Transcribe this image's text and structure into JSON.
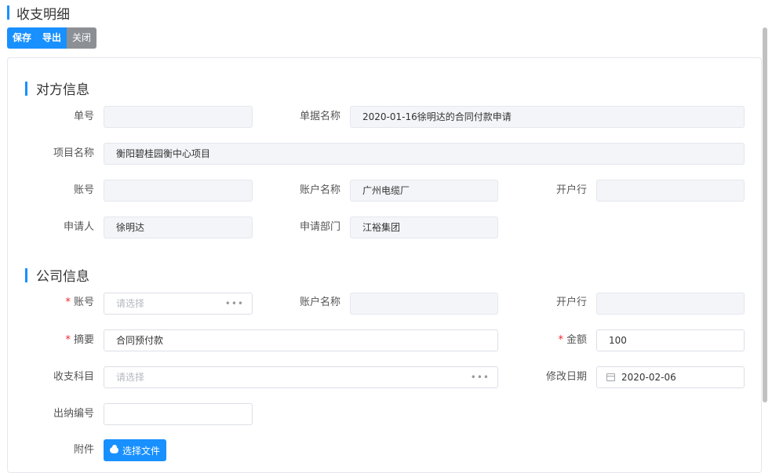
{
  "page": {
    "title": "收支明细"
  },
  "toolbar": {
    "save": "保存",
    "export": "导出",
    "close": "关闭"
  },
  "counterparty": {
    "section_title": "对方信息",
    "doc_no": {
      "label": "单号",
      "value": ""
    },
    "doc_name": {
      "label": "单据名称",
      "value": "2020-01-16徐明达的合同付款申请"
    },
    "project_name": {
      "label": "项目名称",
      "value": "衡阳碧桂园衡中心项目"
    },
    "account_no": {
      "label": "账号",
      "value": ""
    },
    "account_name": {
      "label": "账户名称",
      "value": "广州电缆厂"
    },
    "bank": {
      "label": "开户行",
      "value": ""
    },
    "applicant": {
      "label": "申请人",
      "value": "徐明达"
    },
    "department": {
      "label": "申请部门",
      "value": "江裕集团"
    }
  },
  "company": {
    "section_title": "公司信息",
    "account_no": {
      "label": "账号",
      "placeholder": "请选择",
      "required_mark": "*"
    },
    "account_name": {
      "label": "账户名称",
      "value": ""
    },
    "bank": {
      "label": "开户行",
      "value": ""
    },
    "summary": {
      "label": "摘要",
      "value": "合同预付款",
      "required_mark": "*"
    },
    "amount": {
      "label": "金额",
      "value": "100",
      "required_mark": "*"
    },
    "subject": {
      "label": "收支科目",
      "placeholder": "请选择"
    },
    "modify_date": {
      "label": "修改日期",
      "value": "2020-02-06"
    },
    "cashier_no": {
      "label": "出纳编号",
      "value": ""
    },
    "attachment": {
      "label": "附件",
      "button": "选择文件"
    }
  },
  "picker_dots": "•••",
  "colors": {
    "primary": "#1890ff",
    "gray_button": "#8c9095",
    "required": "#f5222d",
    "disabled_bg": "#f3f5f8"
  },
  "icons": {
    "picker": "ellipsis-icon",
    "date": "calendar-icon",
    "upload": "cloud-upload-icon"
  }
}
